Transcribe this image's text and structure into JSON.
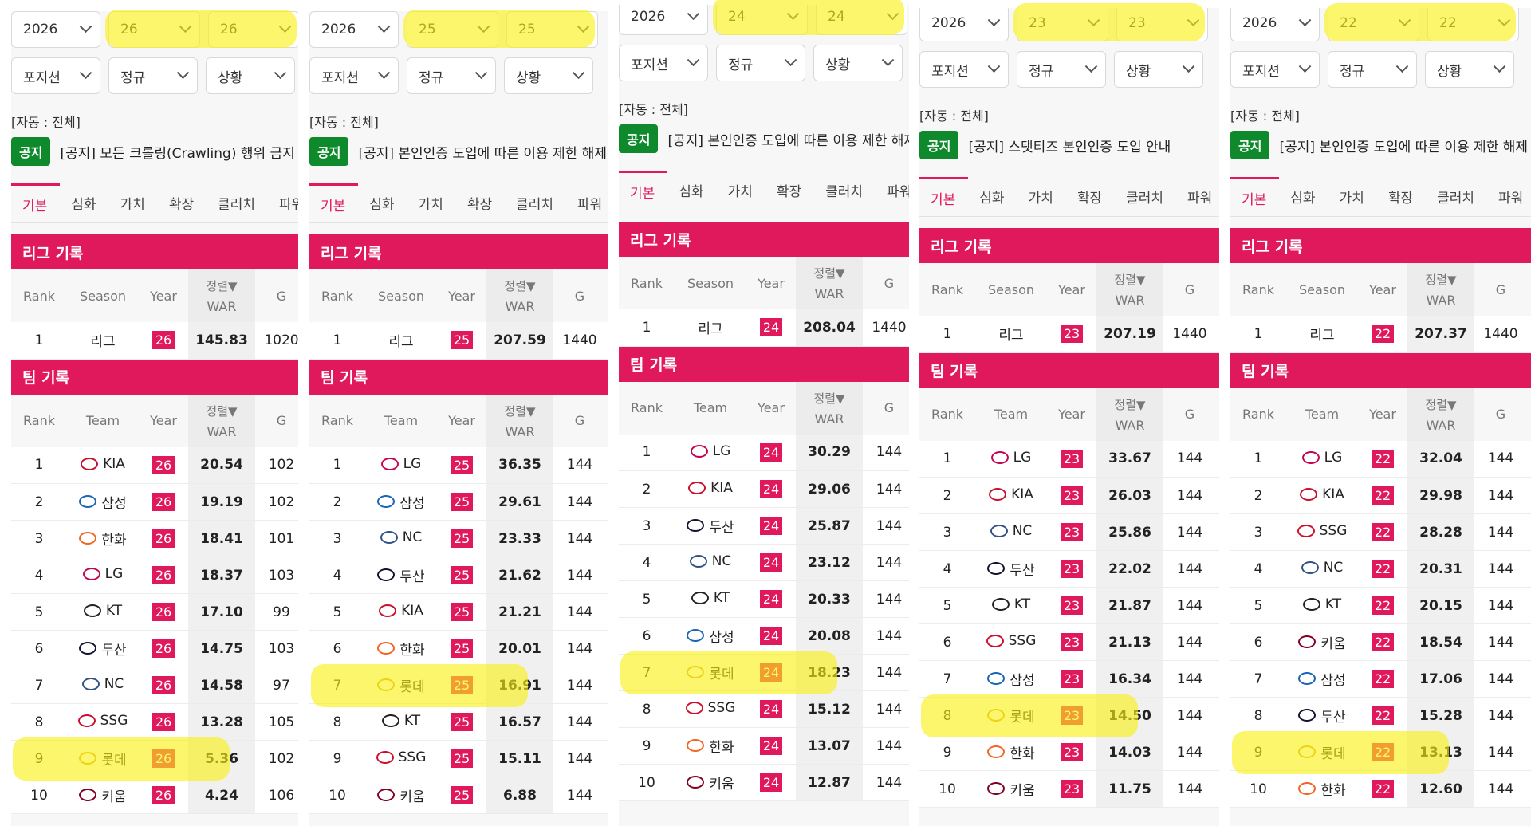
{
  "columns_league": [
    "Rank",
    "Season",
    "Year",
    "G"
  ],
  "columns_team": [
    "Rank",
    "Team",
    "Year",
    "G"
  ],
  "sort_label": "정렬▼",
  "war_label": "WAR",
  "auto_label": "[자동 : 전체]",
  "notice_badge": "공지",
  "tabs": [
    "기본",
    "심화",
    "가치",
    "확장",
    "클러치",
    "파워"
  ],
  "league_section": "리그 기록",
  "team_section": "팀 기록",
  "filters": [
    "포지션",
    "정규",
    "상황"
  ],
  "colors": {
    "accent": "#e0195c",
    "notice_green": "#0e8a2d",
    "highlight": "#f8ef1a"
  },
  "panels": [
    {
      "year_select": "2026",
      "from": "26",
      "to": "26",
      "notice": "[공지] 모든 크롤링(Crawling) 행위 금지",
      "league": {
        "rank": "1",
        "season": "리그",
        "year": "26",
        "war": "145.83",
        "g": "1020"
      },
      "teams": [
        {
          "rank": "1",
          "team": "KIA",
          "year": "26",
          "war": "20.54",
          "g": "102"
        },
        {
          "rank": "2",
          "team": "삼성",
          "year": "26",
          "war": "19.19",
          "g": "102"
        },
        {
          "rank": "3",
          "team": "한화",
          "year": "26",
          "war": "18.41",
          "g": "101"
        },
        {
          "rank": "4",
          "team": "LG",
          "year": "26",
          "war": "18.37",
          "g": "103"
        },
        {
          "rank": "5",
          "team": "KT",
          "year": "26",
          "war": "17.10",
          "g": "99"
        },
        {
          "rank": "6",
          "team": "두산",
          "year": "26",
          "war": "14.75",
          "g": "103"
        },
        {
          "rank": "7",
          "team": "NC",
          "year": "26",
          "war": "14.58",
          "g": "97"
        },
        {
          "rank": "8",
          "team": "SSG",
          "year": "26",
          "war": "13.28",
          "g": "105"
        },
        {
          "rank": "9",
          "team": "롯데",
          "year": "26",
          "war": "5.36",
          "g": "102"
        },
        {
          "rank": "10",
          "team": "키움",
          "year": "26",
          "war": "4.24",
          "g": "106"
        }
      ]
    },
    {
      "year_select": "2026",
      "from": "25",
      "to": "25",
      "notice": "[공지] 본인인증 도입에 따른 이용 제한 해제",
      "league": {
        "rank": "1",
        "season": "리그",
        "year": "25",
        "war": "207.59",
        "g": "1440"
      },
      "teams": [
        {
          "rank": "1",
          "team": "LG",
          "year": "25",
          "war": "36.35",
          "g": "144"
        },
        {
          "rank": "2",
          "team": "삼성",
          "year": "25",
          "war": "29.61",
          "g": "144"
        },
        {
          "rank": "3",
          "team": "NC",
          "year": "25",
          "war": "23.33",
          "g": "144"
        },
        {
          "rank": "4",
          "team": "두산",
          "year": "25",
          "war": "21.62",
          "g": "144"
        },
        {
          "rank": "5",
          "team": "KIA",
          "year": "25",
          "war": "21.21",
          "g": "144"
        },
        {
          "rank": "6",
          "team": "한화",
          "year": "25",
          "war": "20.01",
          "g": "144"
        },
        {
          "rank": "7",
          "team": "롯데",
          "year": "25",
          "war": "16.91",
          "g": "144"
        },
        {
          "rank": "8",
          "team": "KT",
          "year": "25",
          "war": "16.57",
          "g": "144"
        },
        {
          "rank": "9",
          "team": "SSG",
          "year": "25",
          "war": "15.11",
          "g": "144"
        },
        {
          "rank": "10",
          "team": "키움",
          "year": "25",
          "war": "6.88",
          "g": "144"
        }
      ]
    },
    {
      "year_select": "2026",
      "from": "24",
      "to": "24",
      "notice": "[공지] 본인인증 도입에 따른 이용 제한 해제",
      "league": {
        "rank": "1",
        "season": "리그",
        "year": "24",
        "war": "208.04",
        "g": "1440"
      },
      "teams": [
        {
          "rank": "1",
          "team": "LG",
          "year": "24",
          "war": "30.29",
          "g": "144"
        },
        {
          "rank": "2",
          "team": "KIA",
          "year": "24",
          "war": "29.06",
          "g": "144"
        },
        {
          "rank": "3",
          "team": "두산",
          "year": "24",
          "war": "25.87",
          "g": "144"
        },
        {
          "rank": "4",
          "team": "NC",
          "year": "24",
          "war": "23.12",
          "g": "144"
        },
        {
          "rank": "5",
          "team": "KT",
          "year": "24",
          "war": "20.33",
          "g": "144"
        },
        {
          "rank": "6",
          "team": "삼성",
          "year": "24",
          "war": "20.08",
          "g": "144"
        },
        {
          "rank": "7",
          "team": "롯데",
          "year": "24",
          "war": "18.23",
          "g": "144"
        },
        {
          "rank": "8",
          "team": "SSG",
          "year": "24",
          "war": "15.12",
          "g": "144"
        },
        {
          "rank": "9",
          "team": "한화",
          "year": "24",
          "war": "13.07",
          "g": "144"
        },
        {
          "rank": "10",
          "team": "키움",
          "year": "24",
          "war": "12.87",
          "g": "144"
        }
      ]
    },
    {
      "year_select": "2026",
      "from": "23",
      "to": "23",
      "notice": "[공지] 스탯티즈 본인인증 도입 안내",
      "league": {
        "rank": "1",
        "season": "리그",
        "year": "23",
        "war": "207.19",
        "g": "1440"
      },
      "teams": [
        {
          "rank": "1",
          "team": "LG",
          "year": "23",
          "war": "33.67",
          "g": "144"
        },
        {
          "rank": "2",
          "team": "KIA",
          "year": "23",
          "war": "26.03",
          "g": "144"
        },
        {
          "rank": "3",
          "team": "NC",
          "year": "23",
          "war": "25.86",
          "g": "144"
        },
        {
          "rank": "4",
          "team": "두산",
          "year": "23",
          "war": "22.02",
          "g": "144"
        },
        {
          "rank": "5",
          "team": "KT",
          "year": "23",
          "war": "21.87",
          "g": "144"
        },
        {
          "rank": "6",
          "team": "SSG",
          "year": "23",
          "war": "21.13",
          "g": "144"
        },
        {
          "rank": "7",
          "team": "삼성",
          "year": "23",
          "war": "16.34",
          "g": "144"
        },
        {
          "rank": "8",
          "team": "롯데",
          "year": "23",
          "war": "14.50",
          "g": "144"
        },
        {
          "rank": "9",
          "team": "한화",
          "year": "23",
          "war": "14.03",
          "g": "144"
        },
        {
          "rank": "10",
          "team": "키움",
          "year": "23",
          "war": "11.75",
          "g": "144"
        }
      ]
    },
    {
      "year_select": "2026",
      "from": "22",
      "to": "22",
      "notice": "[공지] 본인인증 도입에 따른 이용 제한 해제",
      "league": {
        "rank": "1",
        "season": "리그",
        "year": "22",
        "war": "207.37",
        "g": "1440"
      },
      "teams": [
        {
          "rank": "1",
          "team": "LG",
          "year": "22",
          "war": "32.04",
          "g": "144"
        },
        {
          "rank": "2",
          "team": "KIA",
          "year": "22",
          "war": "29.98",
          "g": "144"
        },
        {
          "rank": "3",
          "team": "SSG",
          "year": "22",
          "war": "28.28",
          "g": "144"
        },
        {
          "rank": "4",
          "team": "NC",
          "year": "22",
          "war": "20.31",
          "g": "144"
        },
        {
          "rank": "5",
          "team": "KT",
          "year": "22",
          "war": "20.15",
          "g": "144"
        },
        {
          "rank": "6",
          "team": "키움",
          "year": "22",
          "war": "18.54",
          "g": "144"
        },
        {
          "rank": "7",
          "team": "삼성",
          "year": "22",
          "war": "17.06",
          "g": "144"
        },
        {
          "rank": "8",
          "team": "두산",
          "year": "22",
          "war": "15.28",
          "g": "144"
        },
        {
          "rank": "9",
          "team": "롯데",
          "year": "22",
          "war": "13.13",
          "g": "144"
        },
        {
          "rank": "10",
          "team": "한화",
          "year": "22",
          "war": "12.60",
          "g": "144"
        }
      ]
    }
  ]
}
